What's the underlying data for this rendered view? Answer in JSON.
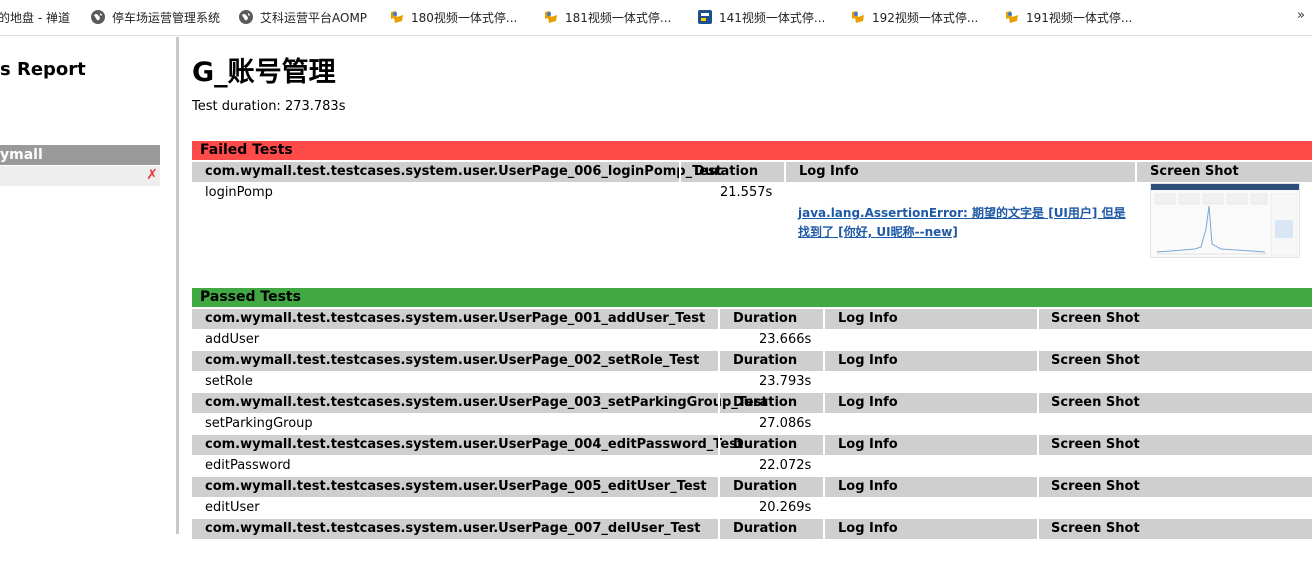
{
  "bookmarks": [
    {
      "label": "的地盘 - 禅道",
      "icon": "none"
    },
    {
      "label": "停车场运营管理系统",
      "icon": "globe-icon"
    },
    {
      "label": "艾科运营平台AOMP",
      "icon": "globe-icon"
    },
    {
      "label": "180视频一体式停...",
      "icon": "bookmark-icon"
    },
    {
      "label": "181视频一体式停...",
      "icon": "bookmark-icon"
    },
    {
      "label": "141视频一体式停...",
      "icon": "app-icon"
    },
    {
      "label": "192视频一体式停...",
      "icon": "bookmark-icon"
    },
    {
      "label": "191视频一体式停...",
      "icon": "bookmark-icon"
    }
  ],
  "bookmarks_more": "»",
  "sidebar": {
    "title": "s Report",
    "group": "ymall",
    "fail_mark": "✗"
  },
  "main": {
    "title": "G_账号管理",
    "duration": "Test duration: 273.783s"
  },
  "failed": {
    "band": "Failed Tests",
    "header": {
      "class": "com.wymall.test.testcases.system.user.UserPage_006_loginPomp_Test",
      "duration": "Duration",
      "log": "Log Info",
      "shot": "Screen Shot"
    },
    "row": {
      "method": "loginPomp",
      "duration": "21.557s",
      "log": "java.lang.AssertionError: 期望的文字是 [UI用户] 但是找到了 [你好, UI昵称--new]"
    }
  },
  "passed": {
    "band": "Passed Tests",
    "labels": {
      "duration": "Duration",
      "log": "Log Info",
      "shot": "Screen Shot"
    },
    "tests": [
      {
        "class": "com.wymall.test.testcases.system.user.UserPage_001_addUser_Test",
        "method": "addUser",
        "duration": "23.666s"
      },
      {
        "class": "com.wymall.test.testcases.system.user.UserPage_002_setRole_Test",
        "method": "setRole",
        "duration": "23.793s"
      },
      {
        "class": "com.wymall.test.testcases.system.user.UserPage_003_setParkingGroup_Test",
        "method": "setParkingGroup",
        "duration": "27.086s"
      },
      {
        "class": "com.wymall.test.testcases.system.user.UserPage_004_editPassword_Test",
        "method": "editPassword",
        "duration": "22.072s"
      },
      {
        "class": "com.wymall.test.testcases.system.user.UserPage_005_editUser_Test",
        "method": "editUser",
        "duration": "20.269s"
      },
      {
        "class": "com.wymall.test.testcases.system.user.UserPage_007_delUser_Test",
        "method": "",
        "duration": ""
      }
    ]
  },
  "colors": {
    "failed": "#ff4a4a",
    "passed": "#41a843",
    "header": "#cfcfcf",
    "link": "#1f5aa6"
  }
}
